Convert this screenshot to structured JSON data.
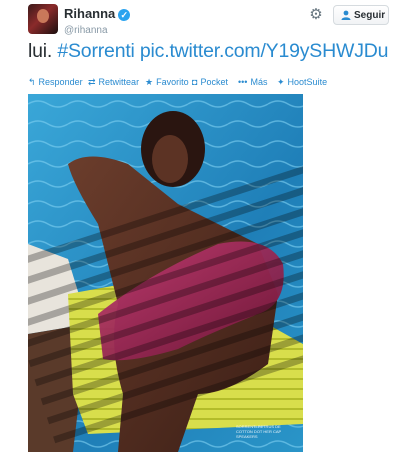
{
  "tweet": {
    "author": {
      "display_name": "Rihanna",
      "handle": "@rihanna",
      "verified_icon": "verified-badge-icon"
    },
    "follow_label": "Seguir",
    "text_plain": "lui. ",
    "hashtag": "#Sorrenti",
    "link": "pic.twitter.com/Y19ySHWJDu",
    "actions": [
      {
        "icon": "reply-icon",
        "label": "Responder"
      },
      {
        "icon": "retweet-icon",
        "label": "Retwittear"
      },
      {
        "icon": "star-icon",
        "label": "Favorito"
      },
      {
        "icon": "pocket-icon",
        "label": "Pocket"
      },
      {
        "icon": "more-icon",
        "label": "Más"
      },
      {
        "icon": "hootsuite-icon",
        "label": "HootSuite"
      }
    ],
    "photo_credit": "SORRENTI PETRUS DE COTTON DOT HER CAP SPEAKERS"
  },
  "colors": {
    "link": "#2a8bd0",
    "text": "#292f33",
    "muted": "#8899a6",
    "verified": "#2aa3ef",
    "pool": "#2a8fc4"
  }
}
